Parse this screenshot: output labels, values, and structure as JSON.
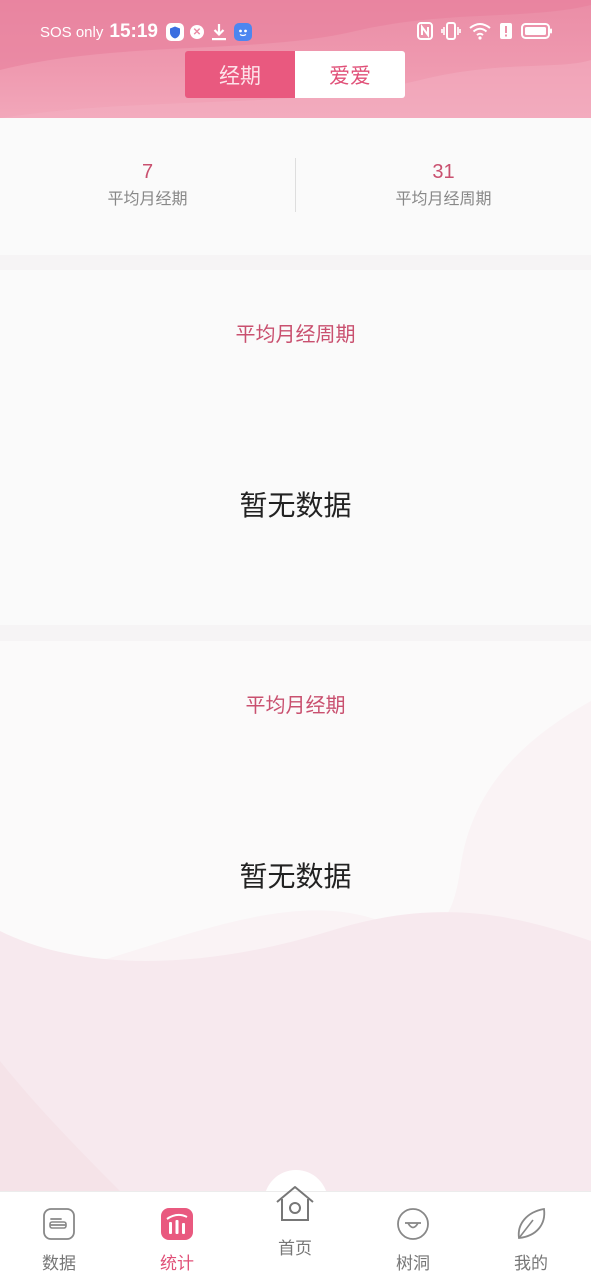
{
  "status_bar": {
    "carrier": "SOS only",
    "time": "15:19",
    "left_icons": [
      "shield-icon",
      "x-circle-icon",
      "download-icon",
      "bot-icon"
    ],
    "right_icons": [
      "nfc-icon",
      "vibrate-icon",
      "wifi-icon",
      "alert-icon",
      "battery-icon"
    ]
  },
  "tabs": [
    {
      "label": "经期",
      "active": true
    },
    {
      "label": "爱爱",
      "active": false
    }
  ],
  "summary": {
    "left": {
      "value": "7",
      "label": "平均月经期"
    },
    "right": {
      "value": "31",
      "label": "平均月经周期"
    }
  },
  "cards": [
    {
      "title": "平均月经周期",
      "empty_text": "暂无数据"
    },
    {
      "title": "平均月经期",
      "empty_text": "暂无数据"
    }
  ],
  "bottom_nav": [
    {
      "label": "数据",
      "icon": "data-icon",
      "active": false
    },
    {
      "label": "统计",
      "icon": "stats-icon",
      "active": true
    },
    {
      "label": "首页",
      "icon": "home-icon",
      "active": false
    },
    {
      "label": "树洞",
      "icon": "tree-hole-icon",
      "active": false
    },
    {
      "label": "我的",
      "icon": "leaf-icon",
      "active": false
    }
  ],
  "colors": {
    "accent": "#e9597f",
    "accent_text": "#c9506f",
    "header": "#ec90a8"
  }
}
